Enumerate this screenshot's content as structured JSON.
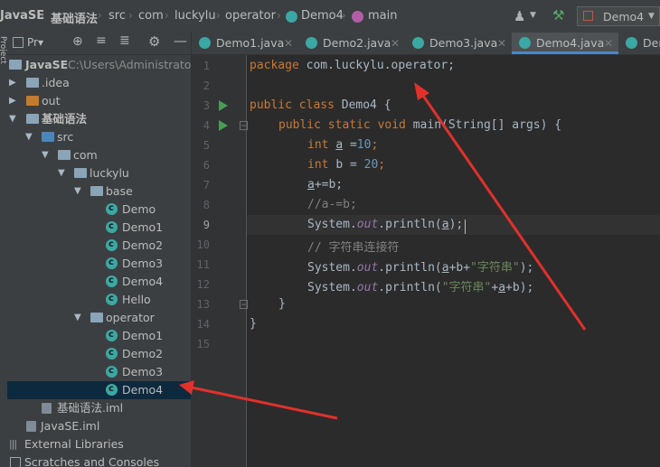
{
  "breadcrumb": [
    "JavaSE",
    "基础语法",
    "src",
    "com",
    "luckylu",
    "operator",
    "Demo4",
    "main"
  ],
  "run_config": {
    "label": "Demo4"
  },
  "project_panel": {
    "title": "Pr▾"
  },
  "side_strip_label": "Project",
  "tree": [
    {
      "label": "JavaSE",
      "path": "C:\\Users\\Administrator\\"
    },
    {
      "label": ".idea"
    },
    {
      "label": "out"
    },
    {
      "label": "基础语法"
    },
    {
      "label": "src"
    },
    {
      "label": "com"
    },
    {
      "label": "luckylu"
    },
    {
      "label": "base"
    },
    {
      "label": "Demo"
    },
    {
      "label": "Demo1"
    },
    {
      "label": "Demo2"
    },
    {
      "label": "Demo3"
    },
    {
      "label": "Demo4"
    },
    {
      "label": "Hello"
    },
    {
      "label": "operator"
    },
    {
      "label": "Demo1"
    },
    {
      "label": "Demo2"
    },
    {
      "label": "Demo3"
    },
    {
      "label": "Demo4"
    },
    {
      "label": "基础语法.iml"
    },
    {
      "label": "JavaSE.iml"
    },
    {
      "label": "External Libraries"
    },
    {
      "label": "Scratches and Consoles"
    }
  ],
  "tabs": [
    {
      "label": "Demo1.java"
    },
    {
      "label": "Demo2.java"
    },
    {
      "label": "Demo3.java"
    },
    {
      "label": "Demo4.java",
      "active": true
    },
    {
      "label": "Der"
    }
  ],
  "line_numbers": [
    "1",
    "2",
    "3",
    "4",
    "5",
    "6",
    "7",
    "8",
    "9",
    "10",
    "11",
    "12",
    "13",
    "14",
    "15"
  ],
  "code": {
    "l1_kw": "package ",
    "l1_rest": "com.luckylu.operator;",
    "l3_kw": "public class ",
    "l3_rest": "Demo4 {",
    "l4_kw": "public static void ",
    "l4_rest": "main(String[] args) {",
    "l5_kw": "int ",
    "l5_var": "a",
    "l5_op": " =",
    "l5_num": "10",
    "l5_end": ";",
    "l6_kw": "int ",
    "l6_rest": "b = ",
    "l6_num": "20",
    "l6_end": ";",
    "l7_a": "a",
    "l7_rest": "+=b;",
    "l8_cmt": "//a-=b;",
    "l9_a": "System.",
    "l9_out": "out",
    "l9_b": ".println(",
    "l9_var": "a",
    "l9_c": ");",
    "l10_cmt": "// 字符串连接符",
    "l11_a": "System.",
    "l11_out": "out",
    "l11_b": ".println(",
    "l11_var": "a",
    "l11_c": "+b+",
    "l11_str": "\"字符串\"",
    "l11_d": ");",
    "l12_a": "System.",
    "l12_out": "out",
    "l12_b": ".println(",
    "l12_str": "\"字符串\"",
    "l12_c": "+",
    "l12_var": "a",
    "l12_d": "+b);",
    "l13": "}",
    "l14": "}"
  },
  "colors": {
    "annotation_arrow": "#e0312b",
    "accent": "#4a88c7"
  }
}
